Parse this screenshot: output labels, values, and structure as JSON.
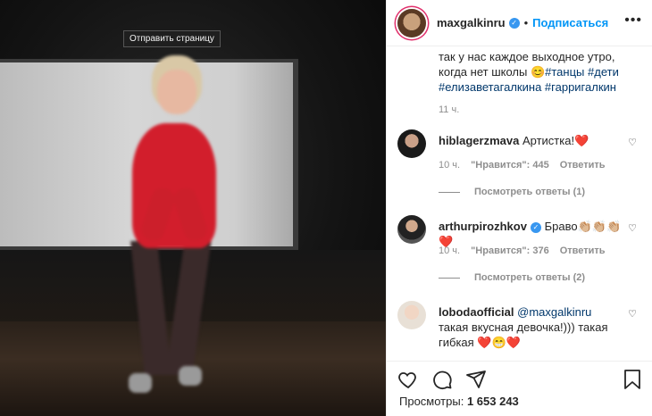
{
  "tooltip": "Отправить страницу",
  "post": {
    "username": "maxgalkinru",
    "separator": "•",
    "follow_label": "Подписаться",
    "more": "•••",
    "caption_lines": [
      "так у нас каждое выходное утро,",
      "когда нет школы"
    ],
    "emoji": "😊",
    "hashtags": [
      "#танцы",
      "#дети",
      "#елизаветагалкина",
      "#гарригалкин"
    ],
    "time": "11 ч."
  },
  "comments": [
    {
      "username": "hiblagerzmava",
      "text": "Артистка!",
      "emoji": "❤️",
      "time": "10 ч.",
      "likes": "\"Нравится\": 445",
      "reply": "Ответить",
      "view_replies": "Посмотреть ответы (1)",
      "verified": false
    },
    {
      "username": "arthurpirozhkov",
      "text": "Браво",
      "emoji": "👏🏼👏🏼👏🏼❤️",
      "time": "10 ч.",
      "likes": "\"Нравится\": 376",
      "reply": "Ответить",
      "view_replies": "Посмотреть ответы (2)",
      "verified": true
    },
    {
      "username": "lobodaofficial",
      "mention": "@maxgalkinru",
      "text_lines": [
        "такая вкусная девочка!))) такая",
        "гибкая"
      ],
      "emoji": "❤️😁❤️",
      "verified": false
    }
  ],
  "views": {
    "label": "Просмотры:",
    "count": "1 653 243"
  },
  "icons": {
    "like": "heart-outline-icon",
    "comment": "comment-bubble-icon",
    "share": "paper-plane-icon",
    "save": "bookmark-icon",
    "verified": "verified-badge-icon"
  },
  "colors": {
    "accent": "#0095f6",
    "link": "#00376b",
    "muted": "#8e8e8e",
    "verified": "#3897f0"
  }
}
